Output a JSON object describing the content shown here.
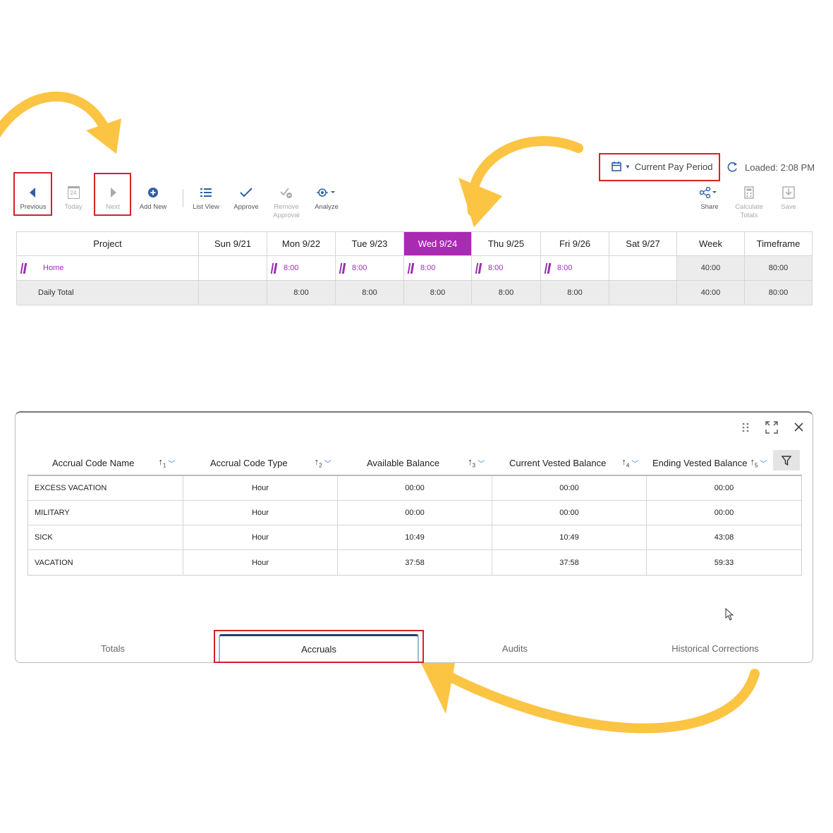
{
  "toolbar": {
    "previous": "Previous",
    "today": "Today",
    "today_day": "24",
    "next": "Next",
    "add_new": "Add New",
    "list_view": "List View",
    "approve": "Approve",
    "remove_approval_1": "Remove",
    "remove_approval_2": "Approval",
    "analyze": "Analyze",
    "share": "Share",
    "calculate_totals_1": "Calculate",
    "calculate_totals_2": "Totals",
    "save": "Save"
  },
  "period": {
    "selector_label": "Current Pay Period",
    "loaded": "Loaded: 2:08 PM"
  },
  "timesheet": {
    "headers": [
      "Project",
      "Sun 9/21",
      "Mon 9/22",
      "Tue 9/23",
      "Wed 9/24",
      "Thu 9/25",
      "Fri 9/26",
      "Sat 9/27",
      "Week",
      "Timeframe"
    ],
    "row": {
      "project": "Home",
      "days": [
        "",
        "8:00",
        "8:00",
        "8:00",
        "8:00",
        "8:00",
        ""
      ],
      "week": "40:00",
      "timeframe": "80:00"
    },
    "total": {
      "label": "Daily Total",
      "days": [
        "",
        "8:00",
        "8:00",
        "8:00",
        "8:00",
        "8:00",
        ""
      ],
      "week": "40:00",
      "timeframe": "80:00"
    }
  },
  "accruals": {
    "headers": [
      {
        "label": "Accrual Code Name",
        "sort": "1"
      },
      {
        "label": "Accrual Code Type",
        "sort": "2"
      },
      {
        "label": "Available Balance",
        "sort": "3"
      },
      {
        "label": "Current Vested Balance",
        "sort": "4"
      },
      {
        "label": "Ending Vested Balance",
        "sort": "5"
      }
    ],
    "rows": [
      [
        "EXCESS VACATION",
        "Hour",
        "00:00",
        "00:00",
        "00:00"
      ],
      [
        "MILITARY",
        "Hour",
        "00:00",
        "00:00",
        "00:00"
      ],
      [
        "SICK",
        "Hour",
        "10:49",
        "10:49",
        "43:08"
      ],
      [
        "VACATION",
        "Hour",
        "37:58",
        "37:58",
        "59:33"
      ]
    ]
  },
  "tabs": [
    "Totals",
    "Accruals",
    "Audits",
    "Historical Corrections"
  ],
  "colors": {
    "accent": "#a92ab3",
    "highlight_box": "#d3222a",
    "arrow": "#fbc443",
    "icon_blue": "#2f5fa8"
  }
}
